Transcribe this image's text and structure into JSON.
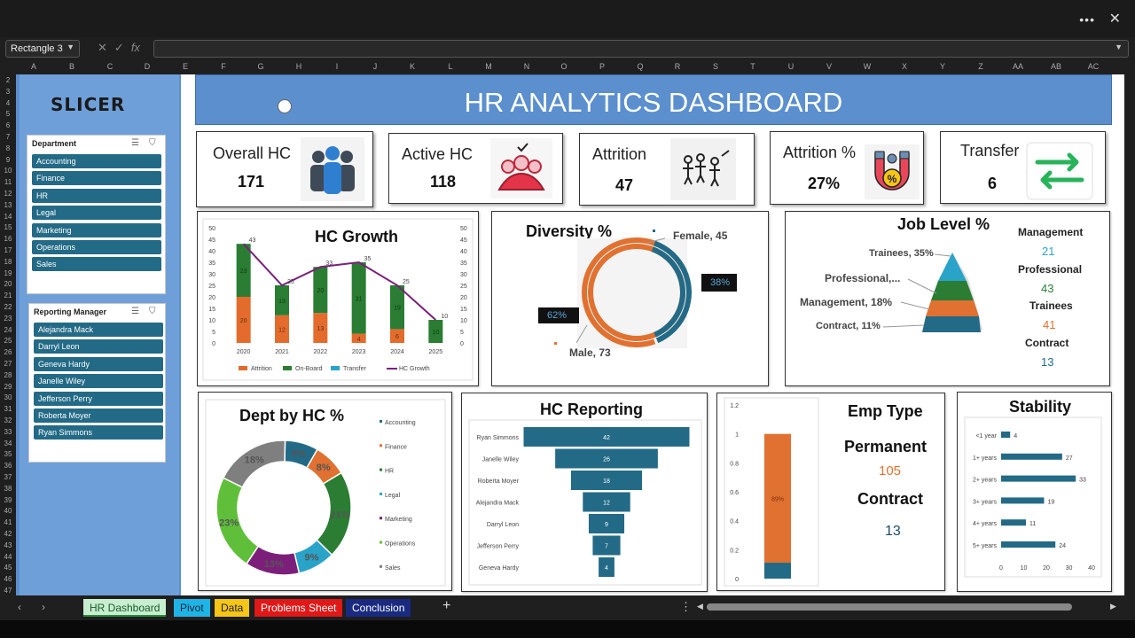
{
  "app": {
    "name_box": "Rectangle 3",
    "fx_label": "fx",
    "menu_glyph": "•••",
    "close_glyph": "✕"
  },
  "columns": [
    "A",
    "B",
    "C",
    "D",
    "E",
    "F",
    "G",
    "H",
    "I",
    "J",
    "K",
    "L",
    "M",
    "N",
    "O",
    "P",
    "Q",
    "R",
    "S",
    "T",
    "U",
    "V",
    "W",
    "X",
    "Y",
    "Z",
    "AA",
    "AB",
    "AC"
  ],
  "rows": [
    "2",
    "3",
    "4",
    "5",
    "6",
    "7",
    "8",
    "9",
    "10",
    "11",
    "12",
    "13",
    "14",
    "15",
    "16",
    "17",
    "18",
    "19",
    "20",
    "21",
    "22",
    "23",
    "24",
    "25",
    "26",
    "27",
    "28",
    "29",
    "30",
    "31",
    "32",
    "33",
    "34",
    "35",
    "36",
    "37",
    "38",
    "39",
    "40",
    "41",
    "42",
    "43",
    "44",
    "45",
    "46",
    "47"
  ],
  "logo": "SLICER",
  "slicers": {
    "department": {
      "title": "Department",
      "items": [
        "Accounting",
        "Finance",
        "HR",
        "Legal",
        "Marketing",
        "Operations",
        "Sales"
      ]
    },
    "manager": {
      "title": "Reporting Manager",
      "items": [
        "Alejandra Mack",
        "Darryl Leon",
        "Geneva Hardy",
        "Janelle Wiley",
        "Jefferson Perry",
        "Roberta Moyer",
        "Ryan Simmons"
      ]
    }
  },
  "banner": "HR ANALYTICS DASHBOARD",
  "kpis": [
    {
      "label": "Overall HC",
      "value": "171",
      "icon": "people-group-icon"
    },
    {
      "label": "Active  HC",
      "value": "118",
      "icon": "team-check-icon"
    },
    {
      "label": "Attrition",
      "value": "47",
      "icon": "leaving-people-icon"
    },
    {
      "label": "Attrition %",
      "value": "27%",
      "icon": "magnet-percent-icon"
    },
    {
      "label": "Transfer",
      "value": "6",
      "icon": "swap-arrows-icon"
    }
  ],
  "colors": {
    "attrition": "#e36c2c",
    "onboard": "#2a7d33",
    "transfer": "#2aa3c9",
    "growth": "#7b1f7a",
    "teal": "#236a86",
    "orange": "#e07130"
  },
  "hc_growth": {
    "title": "HC Growth",
    "categories": [
      "2020",
      "2021",
      "2022",
      "2023",
      "2024",
      "2025"
    ],
    "attrition": [
      20,
      12,
      13,
      4,
      6,
      0
    ],
    "onboard": [
      23,
      13,
      20,
      31,
      19,
      10
    ],
    "transfer": [
      0,
      0,
      0,
      0,
      0,
      0
    ],
    "growth": [
      43,
      25,
      33,
      35,
      25,
      10
    ],
    "growth_labels": [
      "43",
      "25",
      "33",
      "35",
      "25",
      "10"
    ],
    "yticks": [
      "0",
      "5",
      "10",
      "15",
      "20",
      "25",
      "30",
      "35",
      "40",
      "45",
      "50"
    ],
    "legend": [
      "Attrition",
      "On-Board",
      "Transfer",
      "HC Growth"
    ]
  },
  "diversity": {
    "title": "Diversity %",
    "female": "Female, 45",
    "male": "Male, 73",
    "female_pct": "38%",
    "male_pct": "62%"
  },
  "job_level": {
    "title": "Job Level %",
    "labels": [
      "Trainees, 35%",
      "Professional,...",
      "Management, 18%",
      "Contract, 11%"
    ],
    "stats": [
      {
        "label": "Management",
        "value": "21",
        "color": "#2aa3c9"
      },
      {
        "label": "Professional",
        "value": "43",
        "color": "#2a7d33"
      },
      {
        "label": "Trainees",
        "value": "41",
        "color": "#e07130"
      },
      {
        "label": "Contract",
        "value": "13",
        "color": "#236a86"
      }
    ]
  },
  "dept_hc": {
    "title": "Dept by HC %",
    "slices": [
      {
        "name": "Accounting",
        "pct": 8,
        "label": "8%",
        "color": "#236a86"
      },
      {
        "name": "Finance",
        "pct": 8,
        "label": "8%",
        "color": "#e07130"
      },
      {
        "name": "HR",
        "pct": 21,
        "label": "21%",
        "color": "#2a7d33"
      },
      {
        "name": "Legal",
        "pct": 9,
        "label": "9%",
        "color": "#2aa3c9"
      },
      {
        "name": "Marketing",
        "pct": 13,
        "label": "13%",
        "color": "#7b1f7a"
      },
      {
        "name": "Operations",
        "pct": 23,
        "label": "23%",
        "color": "#5fbf3a"
      },
      {
        "name": "Sales",
        "pct": 18,
        "label": "18%",
        "color": "#7f7f7f"
      }
    ]
  },
  "hc_reporting": {
    "title": "HC Reporting",
    "rows": [
      {
        "name": "Ryan Simmons",
        "value": 42
      },
      {
        "name": "Janelle Wiley",
        "value": 26
      },
      {
        "name": "Roberta Moyer",
        "value": 18
      },
      {
        "name": "Alejandra Mack",
        "value": 12
      },
      {
        "name": "Darryl Leon",
        "value": 9
      },
      {
        "name": "Jefferson Perry",
        "value": 7
      },
      {
        "name": "Geneva Hardy",
        "value": 4
      }
    ]
  },
  "emp_type": {
    "title": "Emp Type",
    "permanent_label": "Permanent",
    "permanent_value": "105",
    "contract_label": "Contract",
    "contract_value": "13",
    "bar_label": "89%",
    "permanent_share": 0.89,
    "yticks": [
      "0",
      "0.2",
      "0.4",
      "0.6",
      "0.8",
      "1",
      "1.2"
    ]
  },
  "stability": {
    "title": "Stability",
    "rows": [
      {
        "name": "<1 year",
        "value": 4
      },
      {
        "name": "1+ years",
        "value": 27
      },
      {
        "name": "2+ years",
        "value": 33
      },
      {
        "name": "3+ years",
        "value": 19
      },
      {
        "name": "4+ years",
        "value": 11
      },
      {
        "name": "5+ years",
        "value": 24
      }
    ],
    "xticks": [
      "0",
      "10",
      "20",
      "30",
      "40"
    ]
  },
  "tabs": [
    {
      "label": "HR Dashboard",
      "bg": "#c7efcf",
      "fg": "#1a5a2a"
    },
    {
      "label": "Pivot",
      "bg": "#1fb4e6",
      "fg": "#0b2a3a"
    },
    {
      "label": "Data",
      "bg": "#f5c518",
      "fg": "#222"
    },
    {
      "label": "Problems Sheet",
      "bg": "#e01818",
      "fg": "#fff"
    },
    {
      "label": "Conclusion",
      "bg": "#1a2a80",
      "fg": "#fff"
    }
  ]
}
